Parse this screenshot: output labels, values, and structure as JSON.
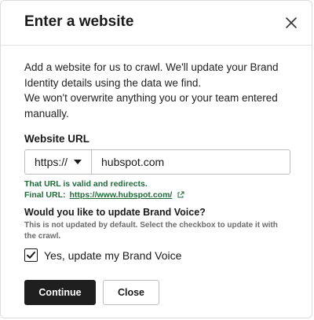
{
  "dialog": {
    "title": "Enter a website",
    "close_icon": "close-icon"
  },
  "intro": {
    "line1": "Add a website for us to crawl. We'll update your Brand Identity details using the data we find.",
    "line2": "We won't overwrite anything you or your team entered manually."
  },
  "url_field": {
    "label": "Website URL",
    "protocol": "https://",
    "value": "hubspot.com",
    "valid_message": "That URL is valid and redirects.",
    "final_url_label": "Final URL:",
    "final_url": "https://www.hubspot.com/",
    "external_icon": "external-link-icon"
  },
  "brand_voice": {
    "question": "Would you like to update Brand Voice?",
    "help": "This is not updated by default. Select the checkbox to update it with the crawl.",
    "checkbox_label": "Yes, update my Brand Voice",
    "checked": true
  },
  "actions": {
    "continue_label": "Continue",
    "close_label": "Close"
  },
  "colors": {
    "success_green": "#1f6b3a",
    "primary_button": "#1f1f1f"
  }
}
